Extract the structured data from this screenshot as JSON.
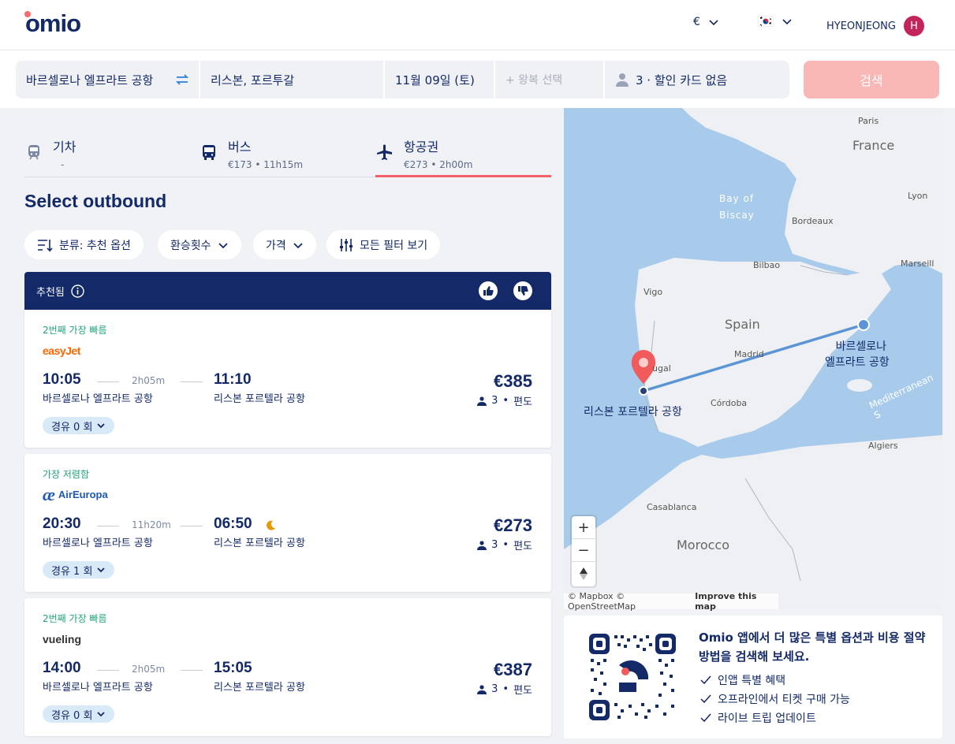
{
  "header": {
    "logo": "omio",
    "currency": "€",
    "user": "HYEONJEONG",
    "avatar_letter": "H"
  },
  "search": {
    "from": "바르셀로나 엘프라트 공항",
    "to": "리스본, 포르투갈",
    "date": "11월 09일 (토)",
    "return_placeholder": "+ 왕복 선택",
    "passengers": "3 · 할인 카드 없음",
    "button": "검색"
  },
  "tabs": [
    {
      "label": "기차",
      "sub": "-"
    },
    {
      "label": "버스",
      "sub": "€173 • 11h15m"
    },
    {
      "label": "항공권",
      "sub": "€273 • 2h00m"
    }
  ],
  "heading": "Select outbound",
  "filters": {
    "sort": "분류: 추천 옵션",
    "transfers": "환승횟수",
    "price": "가격",
    "all": "모든 필터 보기"
  },
  "recommended": "추천됨",
  "results": [
    {
      "tag": "2번째 가장 빠름",
      "airline": "easyJet",
      "dep": "10:05",
      "dur": "2h05m",
      "arr": "11:10",
      "dep_station": "바르셀로나 엘프라트 공항",
      "arr_station": "리스본 포르텔라 공항",
      "price": "€385",
      "pax": "3",
      "trip": "편도",
      "stops": "경유 0 회"
    },
    {
      "tag": "가장 저렴함",
      "airline": "AirEuropa",
      "dep": "20:30",
      "dur": "11h20m",
      "arr": "06:50",
      "dep_station": "바르셀로나 엘프라트 공항",
      "arr_station": "리스본 포르텔라 공항",
      "price": "€273",
      "pax": "3",
      "trip": "편도",
      "stops": "경유 1 회"
    },
    {
      "tag": "2번째 가장 빠름",
      "airline": "vueling",
      "dep": "14:00",
      "dur": "2h05m",
      "arr": "15:05",
      "dep_station": "바르셀로나 엘프라트 공항",
      "arr_station": "리스본 포르텔라 공항",
      "price": "€387",
      "pax": "3",
      "trip": "편도",
      "stops": "경유 0 회"
    }
  ],
  "map": {
    "paris": "Paris",
    "france": "France",
    "bay": "Bay of",
    "biscay": "Biscay",
    "lyon": "Lyon",
    "bordeaux": "Bordeaux",
    "bilbao": "Bilbao",
    "marseille": "Marseill",
    "vigo": "Vigo",
    "spain": "Spain",
    "madrid": "Madrid",
    "portugal": "ugal",
    "cordoba": "Córdoba",
    "algiers": "Algiers",
    "casablanca": "Casablanca",
    "morocco": "Morocco",
    "med": "Mediterranean S",
    "origin_1": "바르셀로나",
    "origin_2": "엘프라트 공항",
    "dest": "리스본 포르텔라 공항",
    "attribution": "© Mapbox © OpenStreetMap",
    "improve": "Improve this map"
  },
  "promo": {
    "title": "Omio 앱에서 더 많은 특별 옵션과 비용 절약 방법을 검색해 보세요.",
    "items": [
      "인앱 특별 혜택",
      "오프라인에서 티켓 구매 가능",
      "라이브 트립 업데이트"
    ]
  }
}
